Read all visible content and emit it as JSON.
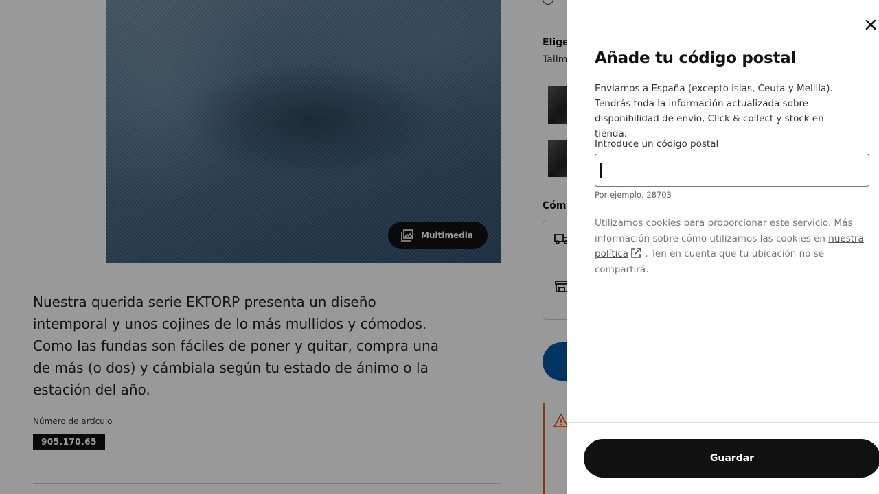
{
  "product": {
    "multimedia_label": "Multimedia",
    "description": "Nuestra querida serie EKTORP presenta un diseño intemporal y unos cojines de lo más mullidos y cómodos. Como las fundas son fáciles de poner y quitar, compra una de más (o dos) y cámbiala según tu estado de ánimo o la estación del año.",
    "article_label": "Número de artículo",
    "article_number": "905.170.65"
  },
  "sidebar": {
    "choose_heading": "Elige",
    "color_name": "Tallmy",
    "how_heading": "Cóm"
  },
  "modal": {
    "title": "Añade tu código postal",
    "intro": "Enviamos a España (excepto islas, Ceuta y Melilla). Tendrás toda la información actualizada sobre disponibilidad de envío, Click & collect y stock en tienda.",
    "field_label": "Introduce un código postal",
    "field_value": "",
    "helper": "Por ejemplo, 28703",
    "cookie_before": "Utilizamos cookies para proporcionar este servicio. Más información sobre cómo utilizamos las cookies en",
    "policy_link": "nuestra política",
    "cookie_after": ". Ten en cuenta que tu ubicación no se compartirá.",
    "save_label": "Guardar"
  },
  "colors": {
    "overlay": "rgba(0,0,0,0.4)",
    "primary_button": "#111111",
    "accent_blue": "#0058a3",
    "warning": "#e05a1c"
  }
}
